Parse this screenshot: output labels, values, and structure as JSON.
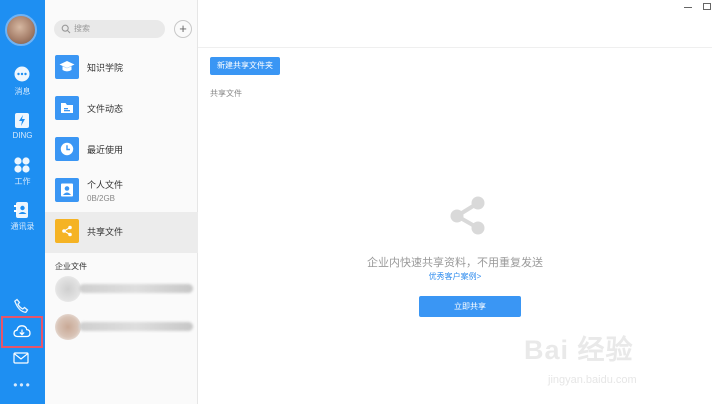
{
  "rail": {
    "items": [
      {
        "name": "messages",
        "label": "消息",
        "icon": "chat-bubble-icon"
      },
      {
        "name": "ding",
        "label": "DING",
        "icon": "ding-icon"
      },
      {
        "name": "work",
        "label": "工作",
        "icon": "apps-grid-icon"
      },
      {
        "name": "contacts",
        "label": "通讯录",
        "icon": "contacts-book-icon"
      }
    ],
    "bottom": [
      "phone-icon",
      "cloud-disk-icon",
      "mail-icon"
    ],
    "more": "•••",
    "colors": {
      "bg": "#1e8ff2",
      "highlight": "#e8546a"
    }
  },
  "panel": {
    "search_placeholder": "搜索",
    "add_label": "+",
    "items": [
      {
        "label": "知识学院",
        "icon": "graduation-cap-icon"
      },
      {
        "label": "文件动态",
        "icon": "folder-icon"
      },
      {
        "label": "最近使用",
        "icon": "clock-icon"
      },
      {
        "label": "个人文件",
        "sub": "0B/2GB",
        "icon": "user-icon"
      },
      {
        "label": "共享文件",
        "icon": "share-icon"
      }
    ],
    "section_title": "企业文件"
  },
  "main": {
    "new_folder_button": "新建共享文件夹",
    "breadcrumb": "共享文件",
    "empty_text": "企业内快速共享资料，不用重复发送",
    "case_link": "优秀客户案例>",
    "share_now_button": "立即共享"
  },
  "window": {
    "minimize": "–",
    "maximize": "□"
  },
  "watermark": {
    "logo": "Bai 经验",
    "url": "jingyan.baidu.com"
  },
  "colors": {
    "accent": "#3a96f4",
    "link": "#2f8cee",
    "share_tile": "#f5b324"
  }
}
